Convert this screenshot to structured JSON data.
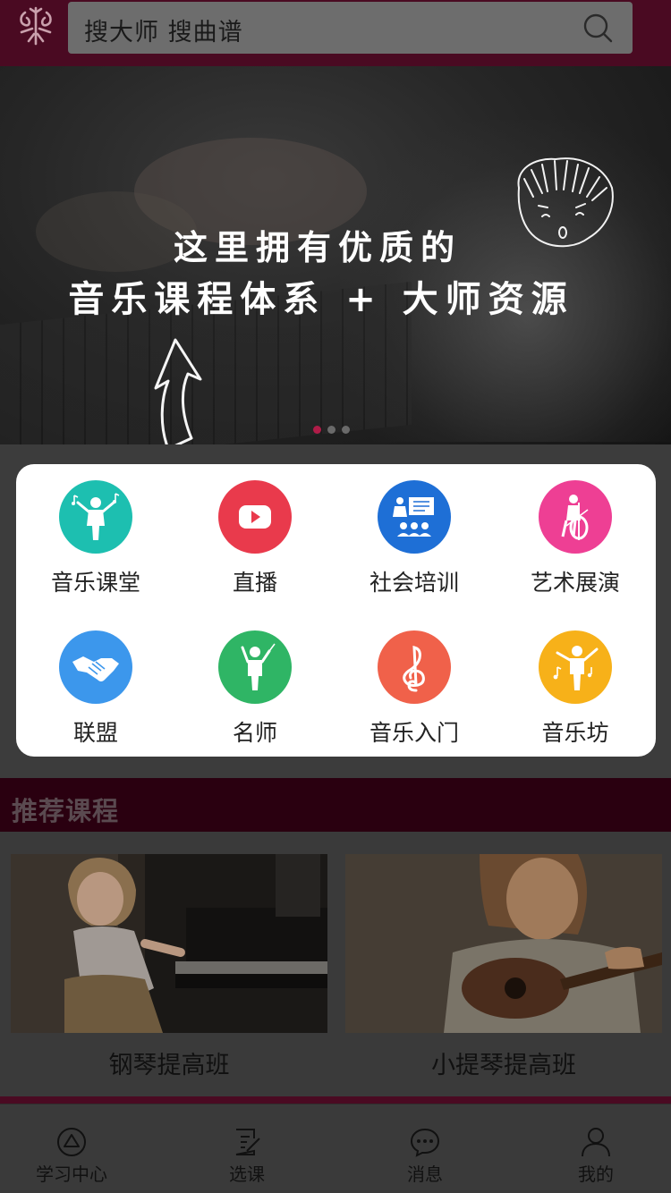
{
  "header": {
    "logo_icon": "music-logo-icon",
    "search_text": "搜大师  搜曲谱",
    "search_icon": "search-icon"
  },
  "banner": {
    "line1": "这里拥有优质的",
    "line2": "音乐课程体系 + 大师资源",
    "slide_count": 3,
    "active_slide": 1
  },
  "grid": {
    "items": [
      {
        "label": "音乐课堂",
        "icon": "conductor-icon",
        "color": "#1dbfb0"
      },
      {
        "label": "直播",
        "icon": "play-icon",
        "color": "#e93a4c"
      },
      {
        "label": "社会培训",
        "icon": "classroom-icon",
        "color": "#1e6fd6"
      },
      {
        "label": "艺术展演",
        "icon": "cello-player-icon",
        "color": "#ee3f94"
      },
      {
        "label": "联盟",
        "icon": "handshake-icon",
        "color": "#3c97ec"
      },
      {
        "label": "名师",
        "icon": "teacher-icon",
        "color": "#2fb565"
      },
      {
        "label": "音乐入门",
        "icon": "treble-clef-icon",
        "color": "#f0614a"
      },
      {
        "label": "音乐坊",
        "icon": "music-performer-icon",
        "color": "#f7b119"
      }
    ]
  },
  "recommended": {
    "title": "推荐课程",
    "courses": [
      {
        "name": "钢琴提高班"
      },
      {
        "name": "小提琴提高班"
      }
    ]
  },
  "tabbar": {
    "items": [
      {
        "label": "学习中心",
        "icon": "learning-center-icon"
      },
      {
        "label": "选课",
        "icon": "course-select-icon"
      },
      {
        "label": "消息",
        "icon": "message-icon"
      },
      {
        "label": "我的",
        "icon": "profile-icon"
      }
    ]
  }
}
